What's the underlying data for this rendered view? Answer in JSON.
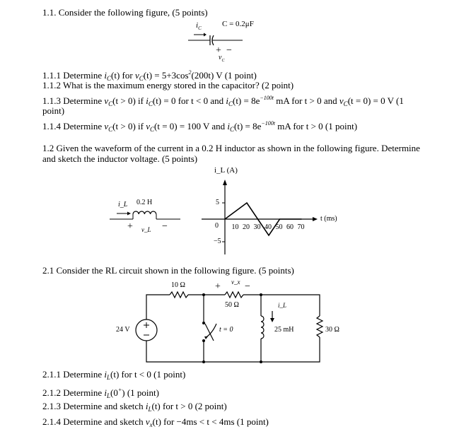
{
  "section_1_1": {
    "heading": [
      [
        "1.1. Consider the following figure,  (5 points)",
        ""
      ]
    ],
    "figure": {
      "current_label": "i",
      "current_sub": "C",
      "cap_label": "C = 0.2μF",
      "plus": "+",
      "minus": "−",
      "voltage_label": "v",
      "voltage_sub": "C"
    },
    "q1": [
      [
        "1.1.1 Determine ",
        ""
      ],
      [
        "i",
        "i"
      ],
      [
        "C",
        "sub"
      ],
      [
        "(t) for ",
        ""
      ],
      [
        "v",
        "i"
      ],
      [
        "C",
        "sub"
      ],
      [
        "(t) = 5+3cos",
        ""
      ],
      [
        "2",
        "sup"
      ],
      [
        "(200t) V  (1 point)",
        ""
      ]
    ],
    "q2": [
      [
        "1.1.2 What is the maximum energy stored in the capacitor? (2 point)",
        ""
      ]
    ],
    "q3": [
      [
        "1.1.3 Determine ",
        ""
      ],
      [
        "v",
        "i"
      ],
      [
        "C",
        "sub"
      ],
      [
        "(t > 0)  if ",
        ""
      ],
      [
        "i",
        "i"
      ],
      [
        "C",
        "sub"
      ],
      [
        "(t) = 0 for t < 0  and ",
        ""
      ],
      [
        "i",
        "i"
      ],
      [
        "C",
        "sub"
      ],
      [
        "(t) = 8e",
        ""
      ],
      [
        "−100t",
        "sup"
      ],
      [
        " mA for t > 0  and ",
        ""
      ],
      [
        "v",
        "i"
      ],
      [
        "C",
        "sub"
      ],
      [
        "(t = 0) = 0 V  (1",
        ""
      ]
    ],
    "q3_cont": [
      [
        "point)",
        ""
      ]
    ],
    "q4": [
      [
        "1.1.4 Determine ",
        ""
      ],
      [
        "v",
        "i"
      ],
      [
        "C",
        "sub"
      ],
      [
        "(t > 0)  if ",
        ""
      ],
      [
        "v",
        "i"
      ],
      [
        "C",
        "sub"
      ],
      [
        "(t = 0) = 100 V  and ",
        ""
      ],
      [
        "i",
        "i"
      ],
      [
        "C",
        "sub"
      ],
      [
        "(t) = 8e",
        ""
      ],
      [
        "−100t",
        "sup"
      ],
      [
        " mA for t > 0  (1 point)",
        ""
      ]
    ]
  },
  "section_1_2": {
    "line1": [
      [
        "1.2 Given the waveform of the current in a 0.2 H inductor as shown in the following figure. Determine",
        ""
      ]
    ],
    "line2": [
      [
        "and sketch the inductor voltage. (5 points)",
        ""
      ]
    ],
    "inductor": {
      "current_label": "i_L",
      "value": "0.2 H",
      "plus": "+",
      "voltage_label": "v_L",
      "minus": "−"
    },
    "graph": {
      "ylabel": "i_L  (A)",
      "xlabel": "t  (ms)",
      "y_ticks": [
        "5",
        "−5"
      ],
      "origin_label": "0",
      "x_ticks": [
        "10",
        "20",
        "30",
        "40",
        "50",
        "60",
        "70"
      ],
      "waveform_ms": [
        0,
        20,
        40,
        50,
        70
      ],
      "waveform_A": [
        0,
        5,
        -5,
        0,
        0
      ]
    }
  },
  "section_2_1": {
    "heading": [
      [
        "2.1 Consider the RL circuit shown in the following figure. (5 points)",
        ""
      ]
    ],
    "circuit": {
      "source": "24 V",
      "r1": "10 Ω",
      "r2": "50 Ω",
      "vx": "v_x",
      "plus": "+",
      "minus": "−",
      "switch": "t = 0",
      "inductor": "25 mH",
      "iL": "i_L",
      "r3": "30 Ω"
    },
    "q1": [
      [
        "2.1.1 Determine ",
        ""
      ],
      [
        "i",
        "i"
      ],
      [
        "L",
        "sub"
      ],
      [
        "(t)  for  t < 0  (1 point)",
        ""
      ]
    ],
    "q2": [
      [
        "2.1.2 Determine ",
        ""
      ],
      [
        "i",
        "i"
      ],
      [
        "L",
        "sub"
      ],
      [
        "(0",
        ""
      ],
      [
        "+",
        "sup"
      ],
      [
        ")  (1 point)",
        ""
      ]
    ],
    "q3": [
      [
        "2.1.3 Determine and sketch ",
        ""
      ],
      [
        "i",
        "i"
      ],
      [
        "L",
        "sub"
      ],
      [
        "(t)  for  t > 0  (2 point)",
        ""
      ]
    ],
    "q4": [
      [
        "2.1.4 Determine and sketch ",
        ""
      ],
      [
        "v",
        "i"
      ],
      [
        "x",
        "sub"
      ],
      [
        "(t)  for  −4ms < t < 4ms  (1 point)",
        ""
      ]
    ]
  }
}
